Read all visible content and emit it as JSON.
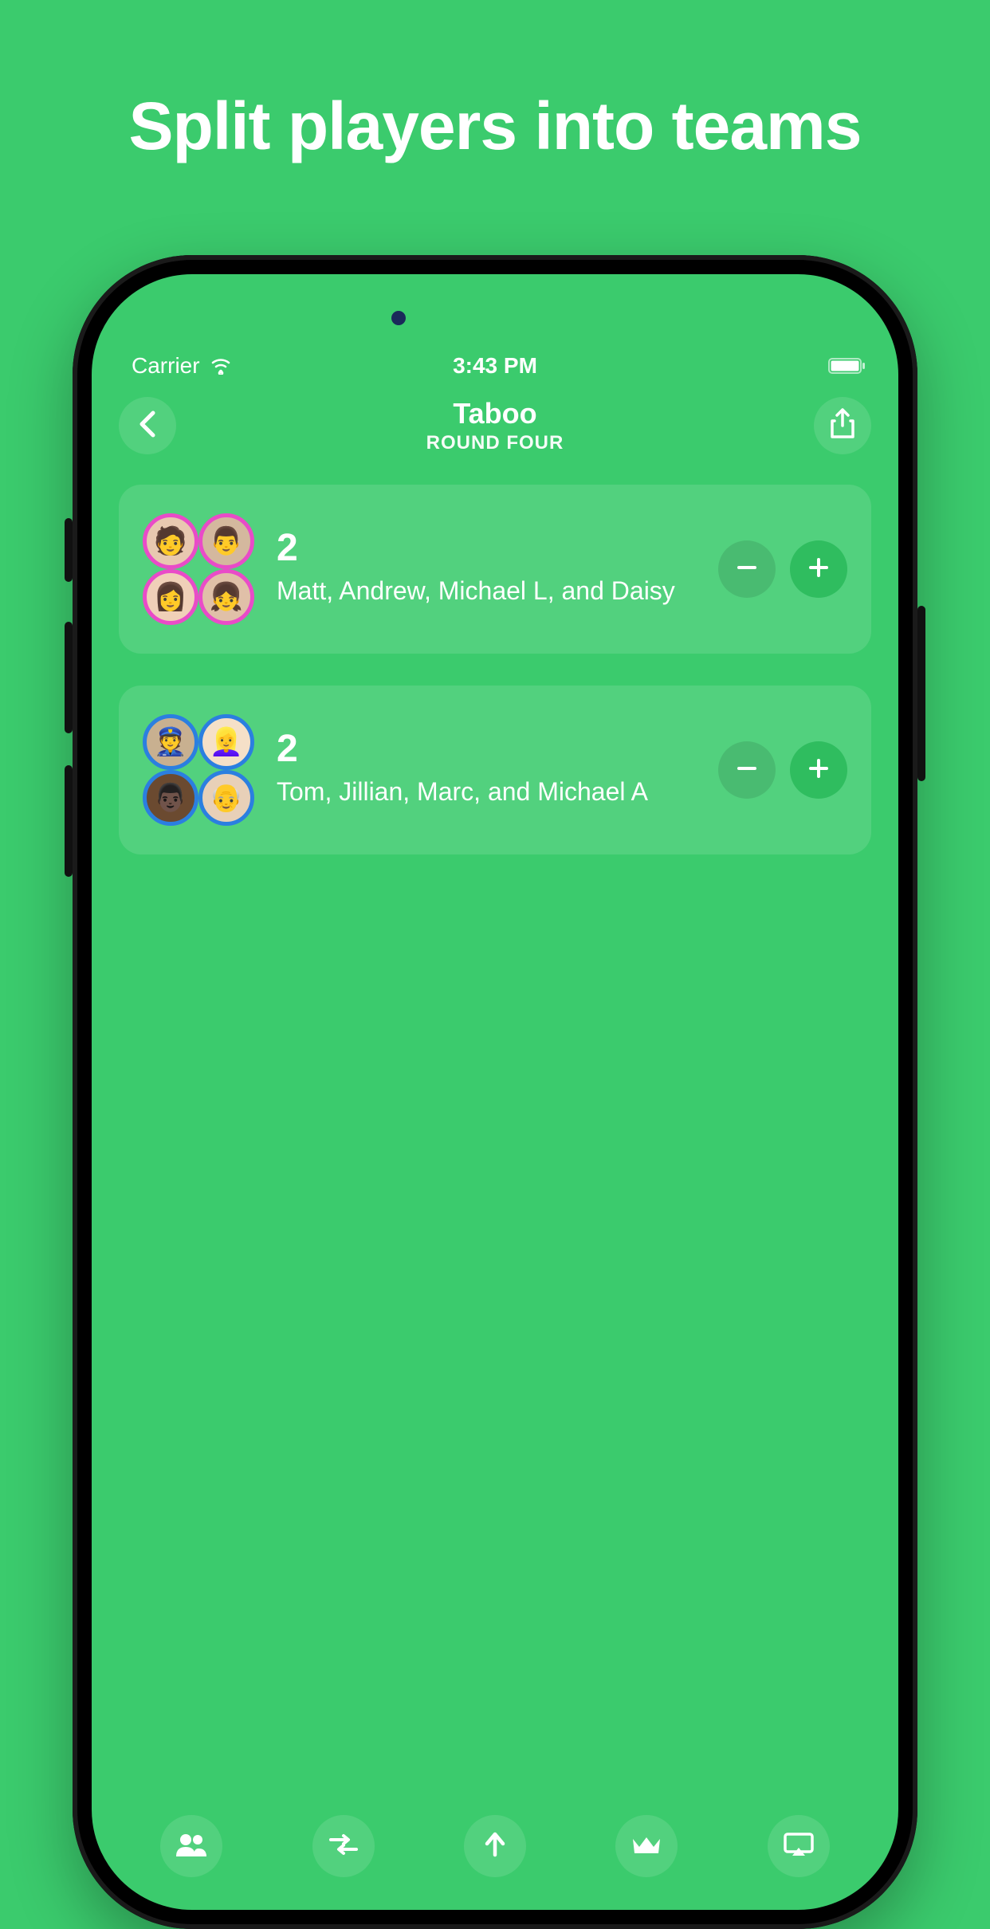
{
  "promo": {
    "headline": "Split players into teams"
  },
  "statusBar": {
    "carrier": "Carrier",
    "time": "3:43 PM"
  },
  "nav": {
    "title": "Taboo",
    "subtitle": "ROUND FOUR"
  },
  "colors": {
    "teamA": "#E94BC8",
    "teamB": "#2B7FE0"
  },
  "teams": [
    {
      "score": "2",
      "members": "Matt, Andrew, Michael L, and Daisy",
      "borderColorKey": "teamA"
    },
    {
      "score": "2",
      "members": "Tom, Jillian, Marc, and Michael A",
      "borderColorKey": "teamB"
    }
  ],
  "icons": {
    "back": "back-icon",
    "share": "share-icon",
    "minus": "minus-icon",
    "plus": "plus-icon",
    "people": "people-icon",
    "shuffle": "shuffle-icon",
    "up": "up-arrow-icon",
    "crown": "crown-icon",
    "airplay": "airplay-icon",
    "wifi": "wifi-icon",
    "battery": "battery-icon"
  }
}
